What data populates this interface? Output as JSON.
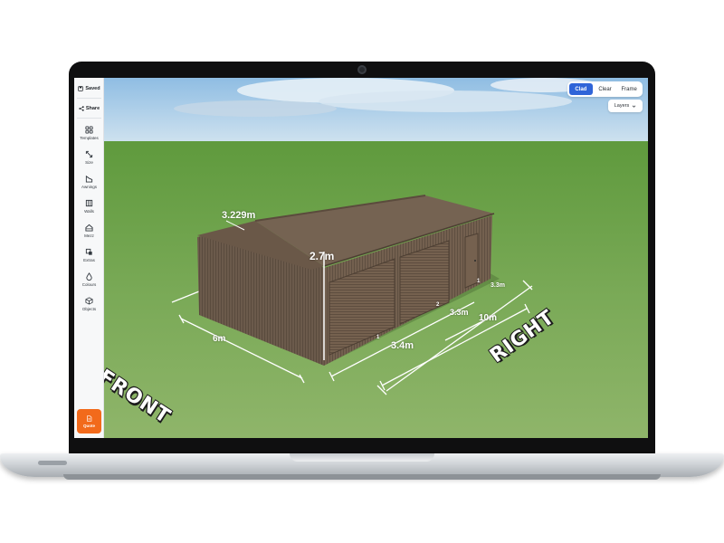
{
  "sidebar": {
    "saved_label": "Saved",
    "share_label": "Share",
    "items": [
      {
        "label": "Templates",
        "icon": "grid-icon"
      },
      {
        "label": "Size",
        "icon": "resize-icon"
      },
      {
        "label": "Awnings",
        "icon": "awning-icon"
      },
      {
        "label": "Walls",
        "icon": "walls-icon"
      },
      {
        "label": "Mezz",
        "icon": "mezzanine-icon"
      },
      {
        "label": "Extras",
        "icon": "extras-icon"
      },
      {
        "label": "Colours",
        "icon": "droplet-icon"
      },
      {
        "label": "Objects",
        "icon": "cube-icon"
      }
    ],
    "quote_label": "Quote"
  },
  "view_toggle": {
    "options": [
      "Clad",
      "Clear",
      "Frame"
    ],
    "selected": "Clad"
  },
  "layers": {
    "label": "Layers"
  },
  "scene": {
    "dimensions": {
      "roof_width": "3.229m",
      "height": "2.7m",
      "front_width": "6m",
      "bay_1": "3.4m",
      "bay_2": "3.3m",
      "bay_3": "3.3m",
      "total_length": "10m"
    },
    "bay_markers": [
      "1",
      "2",
      "1"
    ],
    "side_labels": {
      "front": "FRONT",
      "right": "RIGHT"
    }
  },
  "colors": {
    "accent": "#2f64d8",
    "quote": "#f26a1b",
    "shed": "#6b5a4b",
    "grass": "#7fa657",
    "sky": "#a9cbe6"
  }
}
